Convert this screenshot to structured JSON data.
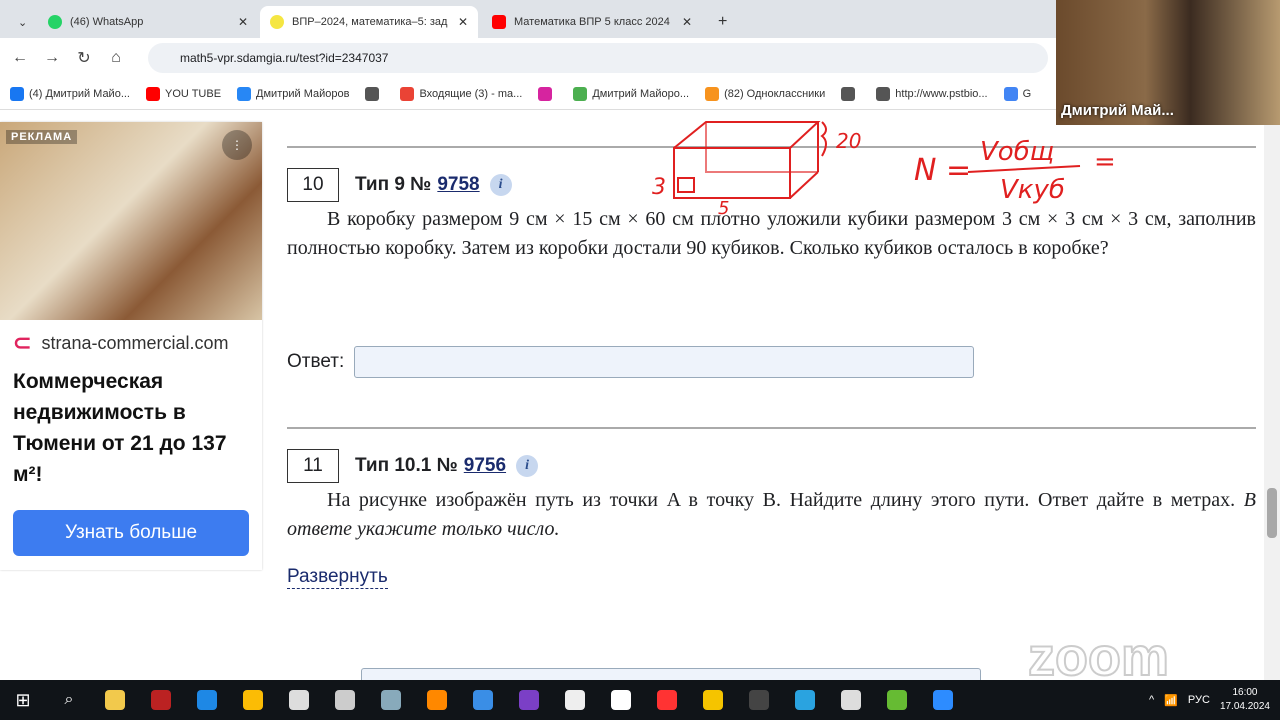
{
  "browser": {
    "tabs": [
      {
        "label": "(46) WhatsApp",
        "icon": "whatsapp-icon",
        "color": "#25d366"
      },
      {
        "label": "ВПР–2024, математика–5: зад",
        "icon": "sdamgia-icon",
        "color": "#f5e642",
        "active": true
      },
      {
        "label": "Математика ВПР 5 класс 2024",
        "icon": "youtube-icon",
        "color": "#ff0000"
      }
    ],
    "url": "math5-vpr.sdamgia.ru/test?id=2347037",
    "bookmarks": [
      {
        "label": "(4) Дмитрий Майо...",
        "color": "#1877f2"
      },
      {
        "label": "YOU TUBE",
        "color": "#ff0000"
      },
      {
        "label": "Дмитрий Майоров",
        "color": "#2787f5"
      },
      {
        "label": "",
        "color": "#555"
      },
      {
        "label": "Входящие (3) - ma...",
        "color": "#ea4335"
      },
      {
        "label": "",
        "color": "#d6249f"
      },
      {
        "label": "Дмитрий Майоро...",
        "color": "#4caf50"
      },
      {
        "label": "(82) Одноклассники",
        "color": "#f7931e"
      },
      {
        "label": "",
        "color": "#555"
      },
      {
        "label": "http://www.pstbio...",
        "color": "#555"
      },
      {
        "label": "G",
        "color": "#4285f4"
      }
    ]
  },
  "ad": {
    "label": "РЕКЛАМА",
    "site": "strana-commercial.com",
    "title": "Коммерческая недвижимость в Тюмени от 21 до 137 м²!",
    "button": "Узнать больше"
  },
  "questions": [
    {
      "num": "10",
      "type": "Тип 9 №",
      "id": "9758",
      "text": "В коробку размером 9 см × 15 см × 60 см плотно уложили кубики размером 3 см × 3 см × 3 см, заполнив полностью коробку. Затем из коробки достали 90 кубиков. Сколько кубиков осталось в коробке?",
      "answer_label": "Ответ:",
      "answer_value": ""
    },
    {
      "num": "11",
      "type": "Тип 10.1 №",
      "id": "9756",
      "text": "На рисунке изображён путь из точки A в точку B. Найдите длину этого пути. Ответ дайте в метрах.",
      "text_italic": "В ответе укажите только число.",
      "expand": "Развернуть"
    }
  ],
  "annotations": {
    "height": "20",
    "side": "3",
    "width": "5",
    "formula_left": "N =",
    "numerator": "Vобщ",
    "denominator": "Vкуб",
    "equals": "="
  },
  "video": {
    "name": "Дмитрий Май..."
  },
  "watermark": "zoom",
  "taskbar": {
    "lang": "РУС",
    "time": "16:00",
    "date": "17.04.2024"
  }
}
